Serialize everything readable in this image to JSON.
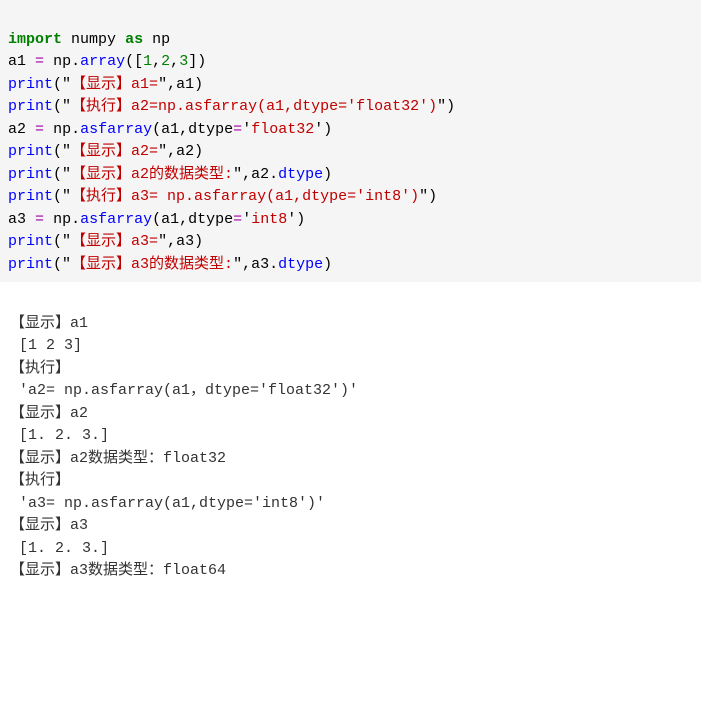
{
  "code": {
    "l1": {
      "kw1": "import",
      "id1": "numpy",
      "kw2": "as",
      "id2": "np"
    },
    "l2": {
      "id1": "a1",
      "op": "=",
      "id2": "np",
      "fn": "array",
      "lp": "([",
      "n1": "1",
      "c1": ",",
      "n2": "2",
      "c2": ",",
      "n3": "3",
      "rp": "])"
    },
    "l3": {
      "fn": "print",
      "lp": "(",
      "q1": "\"",
      "s": "【显示】a1=",
      "q2": "\"",
      "c": ",",
      "id": "a1",
      "rp": ")"
    },
    "l4": {
      "fn": "print",
      "lp": "(",
      "q1": "\"",
      "s": "【执行】a2=np.asfarray(a1,dtype='float32')",
      "q2": "\"",
      "rp": ")"
    },
    "l5": {
      "id1": "a2",
      "op": "=",
      "id2": "np",
      "fn": "asfarray",
      "lp": "(",
      "arg1": "a1",
      "c": ",",
      "arg2": "dtype",
      "eq": "=",
      "q1": "'",
      "s": "float32",
      "q2": "'",
      "rp": ")"
    },
    "l6": {
      "fn": "print",
      "lp": "(",
      "q1": "\"",
      "s": "【显示】a2=",
      "q2": "\"",
      "c": ",",
      "id": "a2",
      "rp": ")"
    },
    "l7": {
      "fn": "print",
      "lp": "(",
      "q1": "\"",
      "s": "【显示】a2的数据类型:",
      "q2": "\"",
      "c": ",",
      "id": "a2",
      "dot": ".",
      "attr": "dtype",
      "rp": ")"
    },
    "l8": {
      "fn": "print",
      "lp": "(",
      "q1": "\"",
      "s": "【执行】a3= np.asfarray(a1,dtype='int8')",
      "q2": "\"",
      "rp": ")"
    },
    "l9": {
      "id1": "a3",
      "op": "=",
      "id2": "np",
      "fn": "asfarray",
      "lp": "(",
      "arg1": "a1",
      "c": ",",
      "arg2": "dtype",
      "eq": "=",
      "q1": "'",
      "s": "int8",
      "q2": "'",
      "rp": ")"
    },
    "l10": {
      "fn": "print",
      "lp": "(",
      "q1": "\"",
      "s": "【显示】a3=",
      "q2": "\"",
      "c": ",",
      "id": "a3",
      "rp": ")"
    },
    "l11": {
      "fn": "print",
      "lp": "(",
      "q1": "\"",
      "s": "【显示】a3的数据类型:",
      "q2": "\"",
      "c": ",",
      "id": "a3",
      "dot": ".",
      "attr": "dtype",
      "rp": ")"
    }
  },
  "output": {
    "l1": "【显示】a1",
    "l2": " [1 2 3]",
    "l3": "【执行】",
    "l4": " 'a2= np.asfarray(a1，dtype='float32')'",
    "l5": "【显示】a2",
    "l6": " [1. 2. 3.]",
    "l7": "【显示】a2数据类型：float32",
    "l8": "【执行】",
    "l9": " 'a3= np.asfarray(a1,dtype='int8')'",
    "l10": "【显示】a3",
    "l11": " [1. 2. 3.]",
    "l12": "【显示】a3数据类型：float64"
  }
}
